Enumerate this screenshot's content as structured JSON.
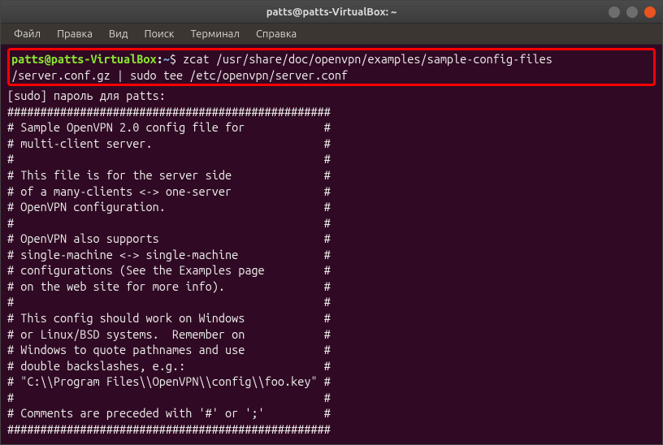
{
  "window": {
    "title": "patts@patts-VirtualBox: ~"
  },
  "menubar": {
    "items": [
      "Файл",
      "Правка",
      "Вид",
      "Поиск",
      "Терминал",
      "Справка"
    ]
  },
  "terminal": {
    "prompt": {
      "user_host": "patts@patts-VirtualBox",
      "colon": ":",
      "path": "~",
      "dollar": "$"
    },
    "command_line1": " zcat /usr/share/doc/openvpn/examples/sample-config-files",
    "command_line2": "/server.conf.gz | sudo tee /etc/openvpn/server.conf",
    "sudo_prompt": "[sudo] пароль для patts:",
    "output": [
      "#################################################",
      "# Sample OpenVPN 2.0 config file for            #",
      "# multi-client server.                          #",
      "#                                               #",
      "# This file is for the server side              #",
      "# of a many-clients <-> one-server              #",
      "# OpenVPN configuration.                        #",
      "#                                               #",
      "# OpenVPN also supports                         #",
      "# single-machine <-> single-machine             #",
      "# configurations (See the Examples page         #",
      "# on the web site for more info).               #",
      "#                                               #",
      "# This config should work on Windows            #",
      "# or Linux/BSD systems.  Remember on            #",
      "# Windows to quote pathnames and use            #",
      "# double backslashes, e.g.:                     #",
      "# \"C:\\\\Program Files\\\\OpenVPN\\\\config\\\\foo.key\" #",
      "#                                               #",
      "# Comments are preceded with '#' or ';'         #",
      "#################################################"
    ]
  }
}
